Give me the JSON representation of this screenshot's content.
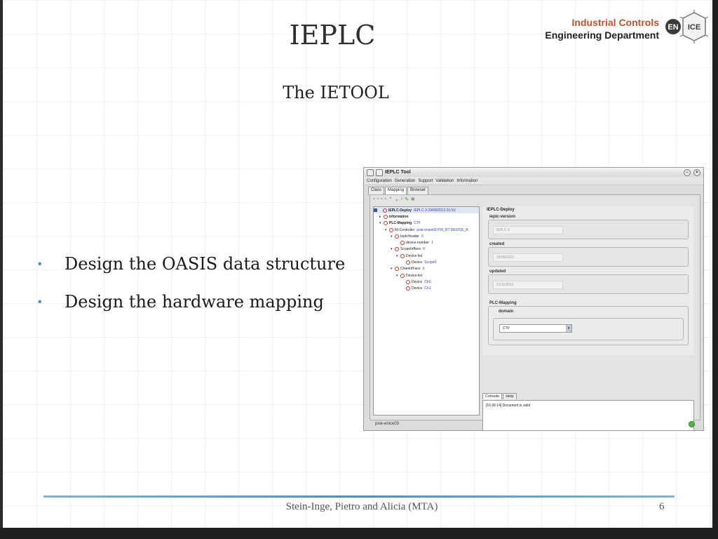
{
  "slide": {
    "title": "IEPLC",
    "subtitle": "The IETOOL",
    "logo": {
      "line1": "Industrial Controls",
      "line2": "Engineering Department",
      "icon_name": "en-ice-logo",
      "badge1": "EN",
      "badge2": "ICE"
    },
    "bullets": [
      "Design the OASIS data structure",
      "Design the hardware mapping"
    ],
    "footer": "Stein-Inge, Pietro and Alicia (MTA)",
    "page_number": "6"
  },
  "tool": {
    "window_title": "IEPLC Tool",
    "menu": [
      "Configuration",
      "Generation",
      "Support",
      "Validation",
      "Information"
    ],
    "tabs": [
      "Class",
      "Mapping",
      "Browser"
    ],
    "active_tab": "Mapping",
    "tree": [
      {
        "label": "IEPLC-Deploy",
        "value": "IEPLC-3  29/08/2013  01/11/",
        "arrow": "",
        "selected": true
      },
      {
        "label": "Information",
        "value": "",
        "arrow": "▸"
      },
      {
        "label": "PLC-Mapping",
        "value": "CTF",
        "arrow": "▾"
      },
      {
        "label": "NI-Controller",
        "value": "pxie-enice03  PXI_RT  DEVICE_R",
        "arrow": "▾"
      },
      {
        "label": "IeplcHeader",
        "value": "0",
        "arrow": "▾"
      },
      {
        "label": "device-number",
        "value": "1",
        "arrow": ""
      },
      {
        "label": "ScopeInfface",
        "value": "0",
        "arrow": "▾"
      },
      {
        "label": "Device-list",
        "value": "",
        "arrow": "▾"
      },
      {
        "label": "Device",
        "value": "Scope0",
        "arrow": ""
      },
      {
        "label": "ChanInfFace",
        "value": "0",
        "arrow": "▾"
      },
      {
        "label": "Device-list",
        "value": "",
        "arrow": "▾"
      },
      {
        "label": "Device",
        "value": "Ch0",
        "arrow": ""
      },
      {
        "label": "Device",
        "value": "Ch1",
        "arrow": ""
      }
    ],
    "props": {
      "header": "IEPLC-Deploy",
      "fields": [
        {
          "label": "ieplc-version",
          "value": "IEPLC-3"
        },
        {
          "label": "created",
          "value": "29/08/2013"
        },
        {
          "label": "updated",
          "value": "01/11/2013"
        }
      ],
      "mapping_header": "PLC-Mapping",
      "domain_label": "domain",
      "domain_value": "CTF"
    },
    "console_tabs": [
      "Console",
      "Help"
    ],
    "console_text": "[16:36:14] Document is valid",
    "status_text": "pxie-enice03"
  }
}
